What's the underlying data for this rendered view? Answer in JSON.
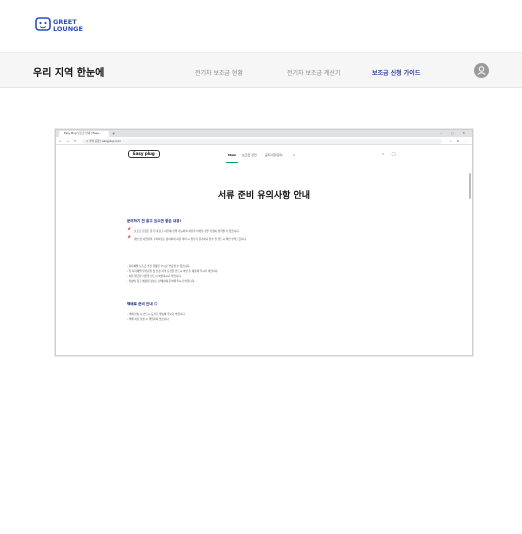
{
  "header": {
    "logo_lines": [
      "GREET",
      "LOUNGE"
    ]
  },
  "subnav": {
    "title": "우리 지역 한눈에",
    "links": [
      "전기차 보조금 현황",
      "전기차 보조금 계산기",
      "보조금 신청 가이드"
    ],
    "active_link": "보조금 신청 가이드"
  },
  "browser": {
    "tab_title": "Easy Plug 보조금 안내 | Easy...",
    "new_tab": "+",
    "window_controls": "–  ▢  ✕",
    "nav_buttons": "←  →  ↻",
    "url": "⚠  주의 요함 | easyplug.co.kr",
    "extensions": "☆  ⧉  ⋮"
  },
  "site": {
    "logo": "Easy plug",
    "menu": [
      "Main",
      "보조금 관련",
      "공지사항/문의",
      "∨"
    ],
    "active_menu": "Main",
    "icons": "⌕  ◯"
  },
  "content": {
    "page_title": "서류 준비 유의사항 안내",
    "section1_title": "문의하기 전 알고 있으면 좋은 내용!",
    "section1_pins": [
      "📌",
      "📌"
    ],
    "section1_lines": [
      "보조금 신청은 한국 내 출고 이후에 진행 가능하며 서류가 미비할 경우 신청이 반려될 수 있습니다.",
      "개인 및 사업자의 구비서류는 상이하며 서류 미비 시 접수가 불가하니 접수 전 반드시 확인 부탁드립니다."
    ],
    "notes": [
      "- 지자체별 보조금 소진 현황은 수시로 변동될 수 있습니다.",
      "- 각 지자체별 우선순위 및 신청 자격 요건을 반드시 확인 후 제출해 주시기 바랍니다.",
      "- 서류 발급일 기준을 반드시 확인하시기 바랍니다.",
      "- 차량의 출고 예정일 정보는 판매사에 문의해 주시기 바랍니다."
    ],
    "section2_title": "택배로 준비 안내 😊",
    "section2_lines": [
      "- 택배 반송 시 반드시 등기로 발송해 주시기 바랍니다.",
      "- 택배 서류 분실 시 책임지지 않습니다."
    ]
  },
  "colors": {
    "accent_navy": "#2b3ea0",
    "logo_blue": "#2a4cc7",
    "site_green": "#13a05f",
    "subnav_bg": "#f6f6f7"
  }
}
